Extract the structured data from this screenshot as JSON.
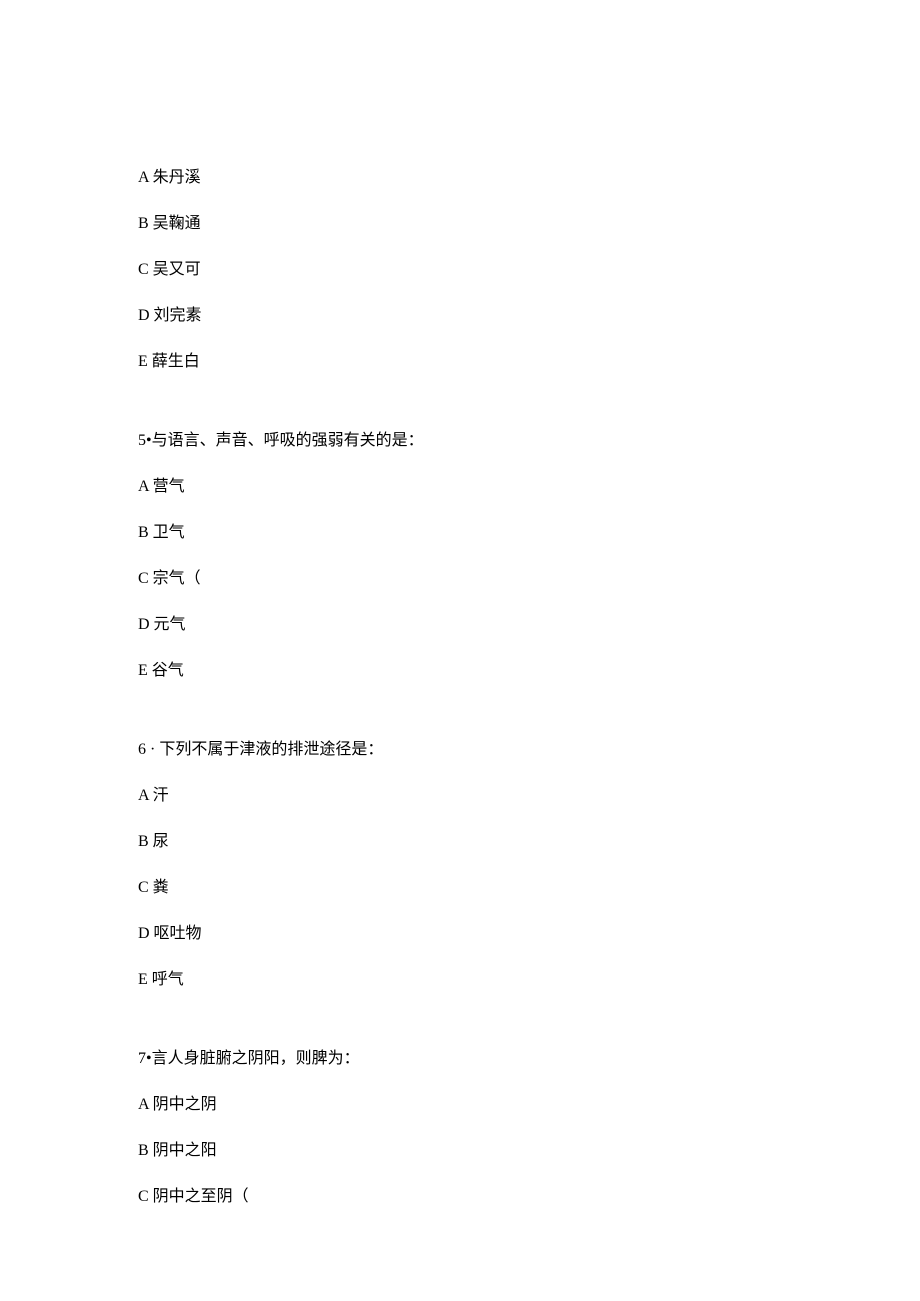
{
  "blocks": [
    {
      "type": "option",
      "text": "A 朱丹溪"
    },
    {
      "type": "option",
      "text": "B 吴鞠通"
    },
    {
      "type": "option",
      "text": "C 吴又可"
    },
    {
      "type": "option",
      "text": "D 刘完素"
    },
    {
      "type": "option",
      "text": "E 薛生白"
    },
    {
      "type": "question",
      "text": "5•与语言、声音、呼吸的强弱有关的是："
    },
    {
      "type": "option",
      "text": "A 营气"
    },
    {
      "type": "option",
      "text": "B 卫气"
    },
    {
      "type": "option",
      "text": "C 宗气（"
    },
    {
      "type": "option",
      "text": "D 元气"
    },
    {
      "type": "option",
      "text": "E 谷气"
    },
    {
      "type": "question",
      "text": "6 · 下列不属于津液的排泄途径是："
    },
    {
      "type": "option",
      "text": "A 汗"
    },
    {
      "type": "option",
      "text": "B 尿"
    },
    {
      "type": "option",
      "text": "C 粪"
    },
    {
      "type": "option",
      "text": "D 呕吐物"
    },
    {
      "type": "option",
      "text": "E 呼气"
    },
    {
      "type": "question",
      "text": "7•言人身脏腑之阴阳，则脾为："
    },
    {
      "type": "option",
      "text": "A 阴中之阴"
    },
    {
      "type": "option",
      "text": "B 阴中之阳"
    },
    {
      "type": "option",
      "text": "C 阴中之至阴（"
    }
  ]
}
